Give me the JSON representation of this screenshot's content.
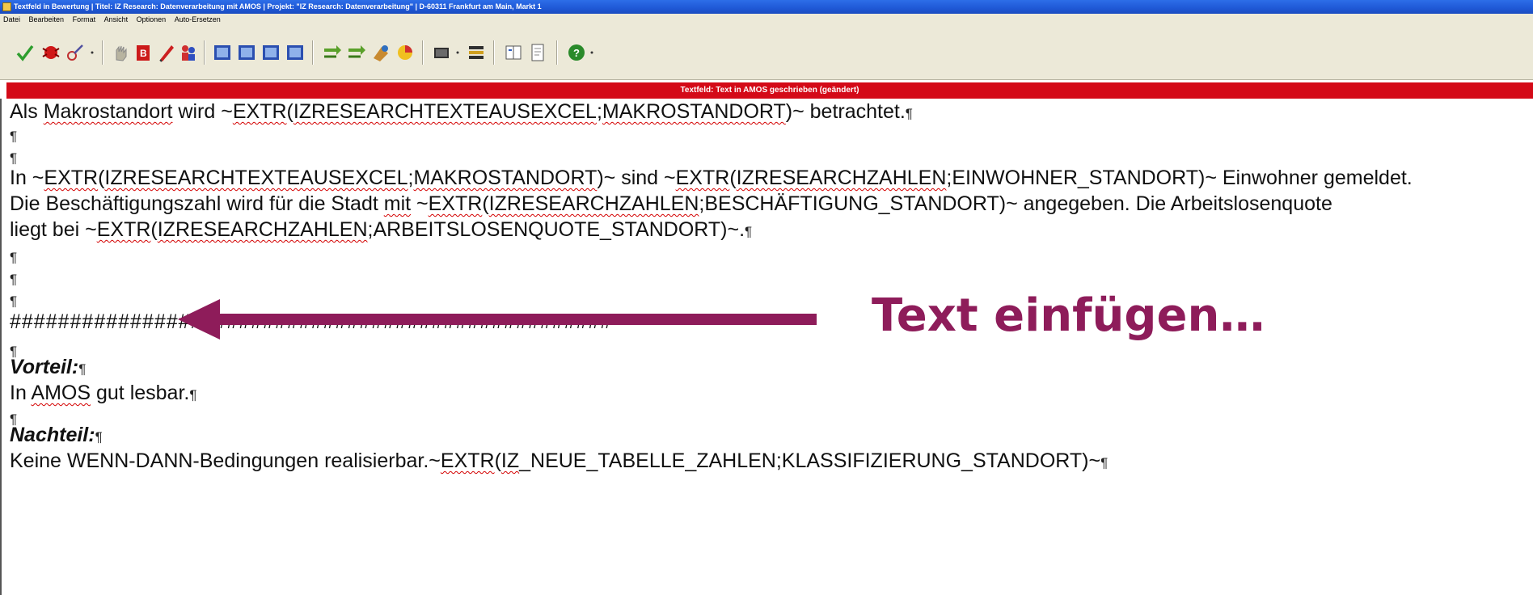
{
  "window": {
    "title": "Textfeld in Bewertung | Titel: IZ Research: Datenverarbeitung mit AMOS | Projekt: \"IZ Research: Datenverarbeitung\" | D-60311 Frankfurt am Main, Markt 1"
  },
  "menu": [
    "Datei",
    "Bearbeiten",
    "Format",
    "Ansicht",
    "Optionen",
    "Auto-Ersetzen"
  ],
  "toolbar": {
    "icons": [
      "check-icon",
      "bug-icon",
      "pen-icon",
      "dropdown-icon",
      "hand-icon",
      "book-red-icon",
      "pencil-icon",
      "figures-icon",
      "view1-icon",
      "view2-icon",
      "view3-icon",
      "view4-icon",
      "arrows1-icon",
      "arrows2-icon",
      "paint-icon",
      "chart-icon",
      "film-icon",
      "list-icon",
      "book-open-icon",
      "document-icon",
      "help-icon"
    ]
  },
  "status": "Textfeld: Text in AMOS geschrieben (geändert)",
  "document": {
    "line1_a": "Als ",
    "line1_b": "Makrostandort",
    "line1_c": " wird ~",
    "line1_d": "EXTR",
    "line1_e": "(",
    "line1_f": "IZRESEARCHTEXTEAUSEXCEL",
    "line1_g": ";",
    "line1_h": "MAKROSTANDORT",
    "line1_i": ")~ betrachtet.",
    "line4_a": "In   ~",
    "line4_b": "EXTR",
    "line4_c": "(",
    "line4_d": "IZRESEARCHTEXTEAUSEXCEL",
    "line4_e": ";",
    "line4_f": "MAKROSTANDORT",
    "line4_g": ")~  sind  ~",
    "line4_h": "EXTR",
    "line4_i": "(",
    "line4_j": "IZRESEARCHZAHLEN",
    "line4_k": ";EINWOHNER_STANDORT)~  Einwohner  gemeldet.",
    "line5_a": "Die  Beschäftigungszahl  wird  für  die  Stadt  ",
    "line5_b": "mit",
    "line5_c": "  ~",
    "line5_d": "EXTR",
    "line5_e": "(",
    "line5_f": "IZRESEARCHZAHLEN",
    "line5_g": ";BESCHÄFTIGUNG_STANDORT)~  angegeben.  Die  Arbeitslosenquote",
    "line6_a": "liegt bei ~",
    "line6_b": "EXTR",
    "line6_c": "(",
    "line6_d": "IZRESEARCHZAHLEN",
    "line6_e": ";ARBEITSLOSENQUOTE_STANDORT)~.",
    "hashes": "##################################################",
    "vorteil_label": "Vorteil:",
    "vorteil_a": "In ",
    "vorteil_b": "AMOS",
    "vorteil_c": " gut lesbar.",
    "nachteil_label": "Nachteil:",
    "nachteil_a": "Keine WENN-DANN-Bedingungen realisierbar.~",
    "nachteil_b": "EXTR",
    "nachteil_c": "(",
    "nachteil_d": "IZ",
    "nachteil_e": "_NEUE_TABELLE_ZAHLEN;KLASSIFIZIERUNG_STANDORT)~",
    "pilcrow": "¶"
  },
  "annotation": {
    "text": "Text einfügen…",
    "color": "#8e1c5a"
  },
  "colors": {
    "status_bg": "#d40a18",
    "titlebar_bg": "#1f58d6"
  }
}
